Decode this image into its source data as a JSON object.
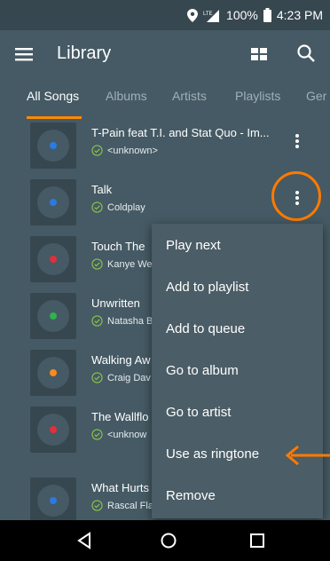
{
  "status_bar": {
    "battery": "100%",
    "time": "4:23 PM",
    "icons": [
      "location-icon",
      "signal-icon",
      "battery-icon"
    ]
  },
  "app_bar": {
    "title": "Library",
    "icons": [
      "menu-icon",
      "grid-view-icon",
      "search-icon"
    ]
  },
  "tabs": [
    {
      "label": "All Songs",
      "active": true
    },
    {
      "label": "Albums",
      "active": false
    },
    {
      "label": "Artists",
      "active": false
    },
    {
      "label": "Playlists",
      "active": false
    },
    {
      "label": "Ger",
      "active": false
    }
  ],
  "songs": [
    {
      "title": "T-Pain feat T.I. and Stat Quo - Im...",
      "artist": "<unknown>",
      "dot_color": "#2a7ae4"
    },
    {
      "title": "Talk",
      "artist": "Coldplay",
      "dot_color": "#2a7ae4"
    },
    {
      "title": "Touch The",
      "artist": "Kanye We",
      "dot_color": "#e0303a"
    },
    {
      "title": "Unwritten",
      "artist": "Natasha B",
      "dot_color": "#2fb34a"
    },
    {
      "title": "Walking Aw",
      "artist": "Craig Dav",
      "dot_color": "#ff8a1a"
    },
    {
      "title": "The Wallflo",
      "artist": "<unknow",
      "dot_color": "#e0303a"
    },
    {
      "title": "What Hurts",
      "artist": "Rascal Flatts",
      "dot_color": "#2a7ae4"
    }
  ],
  "context_menu": {
    "items": [
      "Play next",
      "Add to playlist",
      "Add to queue",
      "Go to album",
      "Go to artist",
      "Use as ringtone",
      "Remove"
    ]
  },
  "annotations": {
    "highlight_color": "#ff7a00"
  },
  "nav_bar": {
    "icons": [
      "back-icon",
      "home-icon",
      "recents-icon"
    ]
  }
}
